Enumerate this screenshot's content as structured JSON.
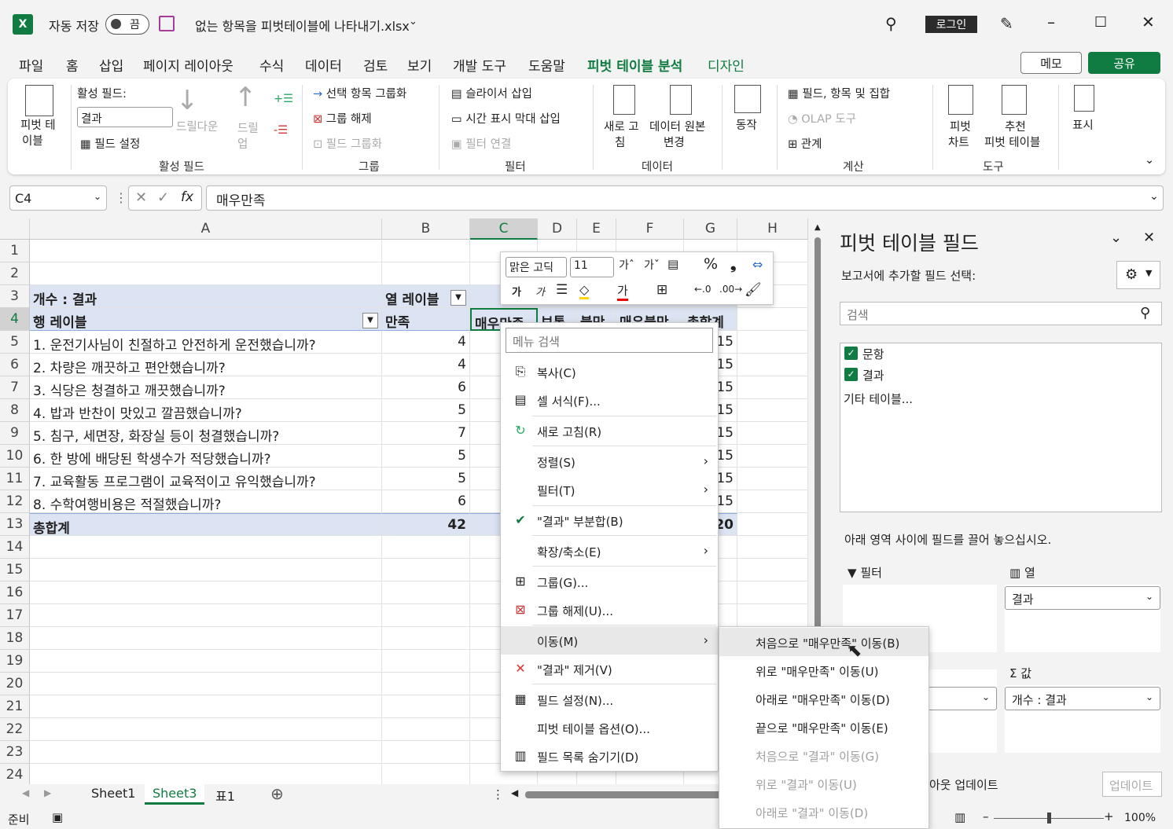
{
  "title": {
    "autosave": "자동 저장",
    "toggle": "끔",
    "filename": "없는 항목을 피벗테이블에 나타내기.xlsx",
    "login": "로그인"
  },
  "menu": [
    "파일",
    "홈",
    "삽입",
    "페이지 레이아웃",
    "수식",
    "데이터",
    "검토",
    "보기",
    "개발 도구",
    "도움말",
    "피벗 테이블 분석",
    "디자인"
  ],
  "menu_right": {
    "memo": "메모",
    "share": "공유"
  },
  "ribbon": {
    "pivot_table": "피벗 테",
    "pivot_table2": "이블",
    "active_field": "활성 필드:",
    "active_field_value": "결과",
    "field_settings": "필드 설정",
    "drill_down": "드릴다운",
    "drill_up": "드릴",
    "drill_up2": "업",
    "group_active": "활성 필드",
    "group_selection": "선택 항목 그룹화",
    "ungroup": "그룹 해제",
    "group_field": "필드 그룹화",
    "group_group": "그룹",
    "insert_slicer": "슬라이서 삽입",
    "insert_timeline": "시간 표시 막대 삽입",
    "filter_connections": "필터 연결",
    "group_filter": "필터",
    "refresh": "새로 고",
    "refresh2": "침",
    "change_source": "데이터 원본",
    "change_source2": "변경",
    "group_data": "데이터",
    "actions": "동작",
    "fields_items": "필드, 항목 및 집합",
    "olap": "OLAP 도구",
    "relationships": "관계",
    "group_calc": "계산",
    "pivot_chart": "피벗",
    "pivot_chart2": "차트",
    "recommended": "추천",
    "recommended2": "피벗 테이블",
    "group_tools": "도구",
    "show": "표시"
  },
  "formula_bar": {
    "name_box": "C4",
    "fx": "fx",
    "formula": "매우만족"
  },
  "columns": [
    "A",
    "B",
    "C",
    "D",
    "E",
    "F",
    "G",
    "H"
  ],
  "rows": [
    "1",
    "2",
    "3",
    "4",
    "5",
    "6",
    "7",
    "8",
    "9",
    "10",
    "11",
    "12",
    "13",
    "14",
    "15",
    "16",
    "17",
    "18",
    "19",
    "20",
    "21",
    "22",
    "23",
    "24"
  ],
  "pivot": {
    "corner": "개수 : 결과",
    "col_labels": "열 레이블",
    "row_labels": "행 레이블",
    "col_headers": [
      "만족",
      "매우만족",
      "보통",
      "불만",
      "매우불만",
      "총합계"
    ],
    "items": [
      {
        "label": "1. 운전기사님이 친절하고 안전하게 운전했습니까?",
        "b": "4",
        "g": "15"
      },
      {
        "label": "2. 차량은 깨끗하고 편안했습니까?",
        "b": "4",
        "g": "15"
      },
      {
        "label": "3. 식당은 청결하고 깨끗했습니까?",
        "b": "6",
        "g": "15"
      },
      {
        "label": "4. 밥과 반찬이 맛있고 깔끔했습니까?",
        "b": "5",
        "g": "15"
      },
      {
        "label": "5. 침구, 세면장, 화장실 등이 청결했습니까?",
        "b": "7",
        "g": "15"
      },
      {
        "label": "6. 한 방에 배당된 학생수가 적당했습니까?",
        "b": "5",
        "g": "15"
      },
      {
        "label": "7. 교육활동 프로그램이 교육적이고 유익했습니까?",
        "b": "5",
        "g": "15"
      },
      {
        "label": "8. 수학여행비용은 적절했습니까?",
        "b": "6",
        "g": "15"
      }
    ],
    "total_label": "총합계",
    "total_b": "42",
    "total_g": "120"
  },
  "sheets": [
    "Sheet1",
    "Sheet3",
    "표1"
  ],
  "status": {
    "ready": "준비",
    "zoom": "100%"
  },
  "pane": {
    "title": "피벗 테이블 필드",
    "subtitle": "보고서에 추가할 필드 선택:",
    "search": "검색",
    "fields": [
      "문항",
      "결과"
    ],
    "more_tables": "기타 테이블...",
    "drag_hint": "아래 영역 사이에 필드를 끌어 놓으십시오.",
    "filter": "필터",
    "columns": "열",
    "col_value": "결과",
    "values": "값",
    "values_value": "개수 : 결과",
    "defer": "아웃 업데이트",
    "update": "업데이트"
  },
  "mini_toolbar": {
    "font": "맑은 고딕",
    "size": "11"
  },
  "context_menu": {
    "search": "메뉴 검색",
    "items": [
      "복사(C)",
      "셀 서식(F)...",
      "새로 고침(R)",
      "정렬(S)",
      "필터(T)",
      "\"결과\" 부분합(B)",
      "확장/축소(E)",
      "그룹(G)...",
      "그룹 해제(U)...",
      "이동(M)",
      "\"결과\" 제거(V)",
      "필드 설정(N)...",
      "피벗 테이블 옵션(O)...",
      "필드 목록 숨기기(D)"
    ]
  },
  "submenu": [
    "처음으로 \"매우만족\" 이동(B)",
    "위로 \"매우만족\" 이동(U)",
    "아래로 \"매우만족\" 이동(D)",
    "끝으로 \"매우만족\" 이동(E)",
    "처음으로 \"결과\" 이동(G)",
    "위로 \"결과\" 이동(U)",
    "아래로 \"결과\" 이동(D)"
  ]
}
